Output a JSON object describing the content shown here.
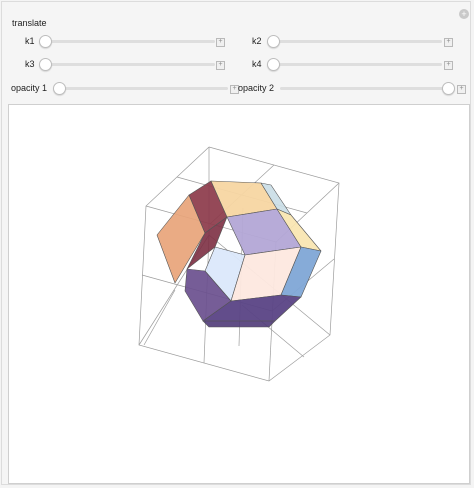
{
  "controls": {
    "section_label": "translate",
    "sliders": [
      {
        "id": "k1",
        "label": "k1",
        "value": 0
      },
      {
        "id": "k2",
        "label": "k2",
        "value": 0
      },
      {
        "id": "k3",
        "label": "k3",
        "value": 0
      },
      {
        "id": "k4",
        "label": "k4",
        "value": 0
      },
      {
        "id": "opacity1",
        "label": "opacity 1",
        "value": 0
      },
      {
        "id": "opacity2",
        "label": "opacity 2",
        "value": 1
      }
    ],
    "expand_symbol": "+",
    "reset_symbol": "+"
  },
  "colors": {
    "dark_red": "#8c3a4a",
    "orange": "#e8a47a",
    "light_orange": "#f7d6a2",
    "lavender": "#b3a7d6",
    "light_blue": "#dbe8fb",
    "light_peach": "#fde8df",
    "purple": "#6a4f8e",
    "dark_purple": "#5a4385",
    "blue": "#7fa6d6",
    "pale_yellow": "#f8e5b0",
    "pale_blue": "#c9dde6"
  }
}
